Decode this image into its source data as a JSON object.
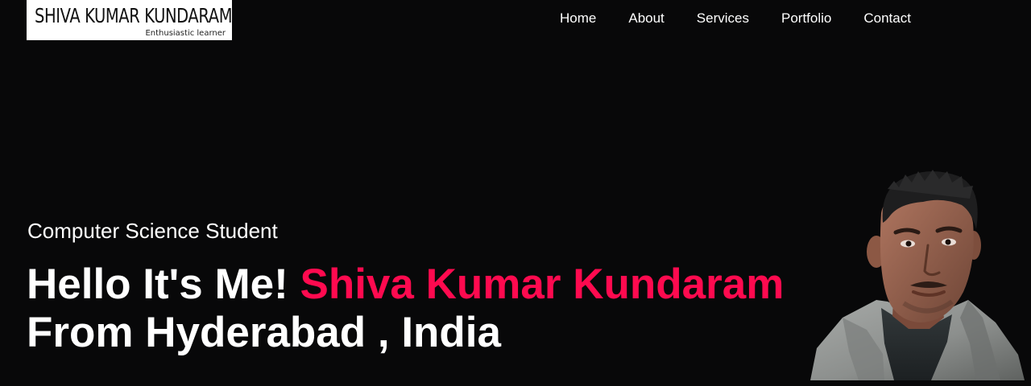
{
  "logo": {
    "title": "SHIVA KUMAR KUNDARAM",
    "tagline": "Enthusiastic learner"
  },
  "nav": {
    "items": [
      "Home",
      "About",
      "Services",
      "Portfolio",
      "Contact"
    ]
  },
  "hero": {
    "subtitle": "Computer Science Student",
    "greeting": "Hello It's Me! ",
    "name": "Shiva Kumar Kundaram",
    "location": "From Hyderabad , India"
  },
  "colors": {
    "background": "#080809",
    "accent": "#ff0a4f",
    "text": "#ffffff"
  },
  "icons": {
    "portrait": "profile-photo"
  }
}
